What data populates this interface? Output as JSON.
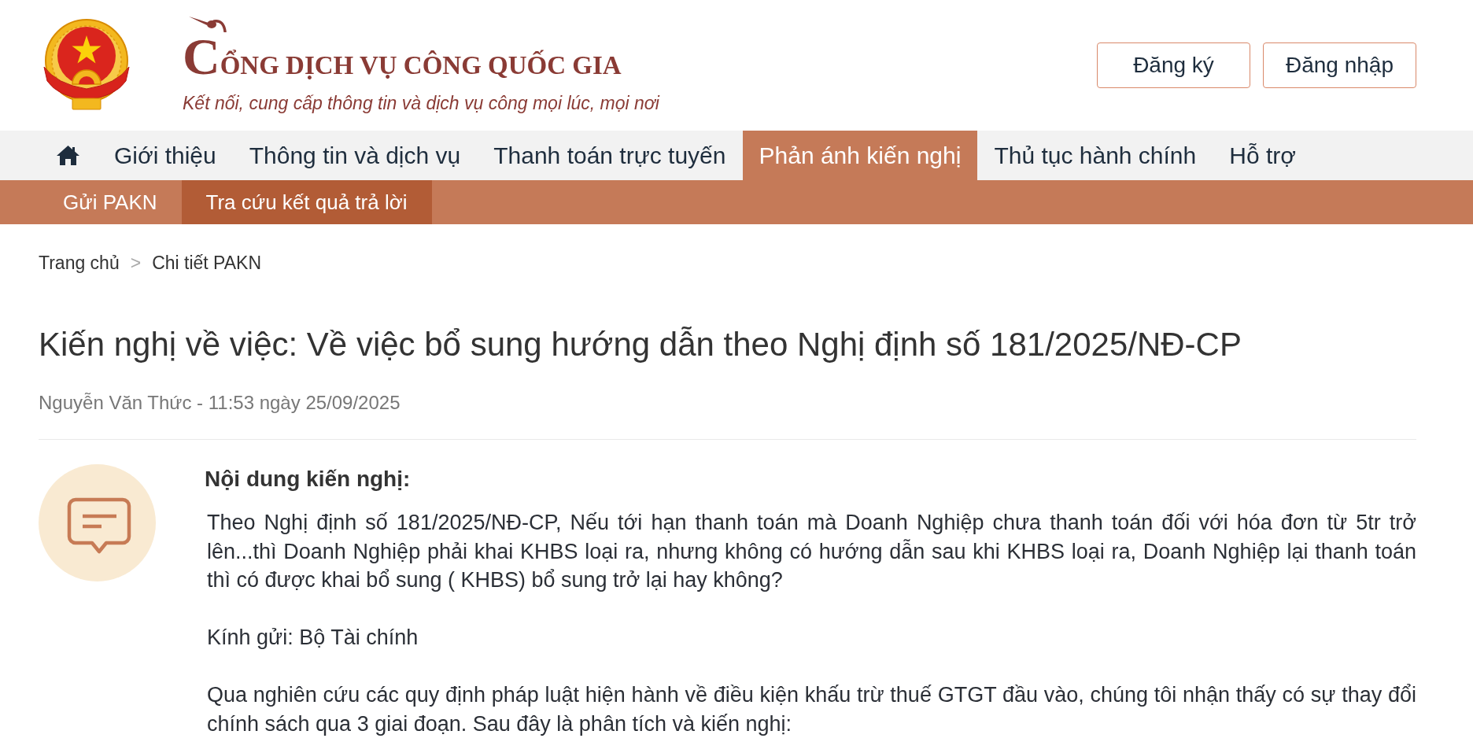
{
  "header": {
    "title": "CỔNG DỊCH VỤ CÔNG QUỐC GIA",
    "tagline": "Kết nối, cung cấp thông tin và dịch vụ công mọi lúc, mọi nơi",
    "register_button": {
      "label": "Đăng ký"
    },
    "login_button": {
      "label": "Đăng nhập"
    }
  },
  "nav": {
    "items": [
      {
        "kind": "home",
        "selected": false
      },
      {
        "kind": "link",
        "label": "Giới thiệu",
        "selected": false
      },
      {
        "kind": "link",
        "label": "Thông tin và dịch vụ",
        "selected": false
      },
      {
        "kind": "link",
        "label": "Thanh toán trực tuyến",
        "selected": false
      },
      {
        "kind": "link",
        "label": "Phản ánh kiến nghị",
        "selected": true
      },
      {
        "kind": "link",
        "label": "Thủ tục hành chính",
        "selected": false
      },
      {
        "kind": "link",
        "label": "Hỗ trợ",
        "selected": false
      }
    ]
  },
  "subnav": {
    "items": [
      {
        "label": "Gửi PAKN",
        "selected": false
      },
      {
        "label": "Tra cứu kết quả trả lời",
        "selected": true
      }
    ]
  },
  "breadcrumb": {
    "items": [
      "Trang chủ",
      "Chi tiết PAKN"
    ],
    "separator": ">"
  },
  "article": {
    "title": "Kiến nghị về việc: Về việc bổ sung hướng dẫn theo Nghị định số 181/2025/NĐ-CP",
    "meta": "Nguyễn Văn Thức - 11:53 ngày 25/09/2025",
    "section_heading": "Nội dung kiến nghị:",
    "paragraphs": [
      "Theo Nghị định số 181/2025/NĐ-CP, Nếu tới hạn thanh toán mà Doanh Nghiệp chưa thanh toán đối với hóa đơn từ 5tr trở lên...thì Doanh Nghiệp phải khai KHBS loại ra, nhưng không có hướng dẫn sau khi KHBS loại ra, Doanh Nghiệp lại thanh toán thì có được khai bổ sung ( KHBS) bổ sung trở lại hay không?",
      "Kính gửi: Bộ Tài chính",
      "Qua nghiên cứu các quy định pháp luật hiện hành về điều kiện khấu trừ thuế GTGT đầu vào, chúng tôi nhận thấy có sự thay đổi chính sách qua 3 giai đoạn. Sau đây là phân tích và kiến nghị:"
    ]
  }
}
